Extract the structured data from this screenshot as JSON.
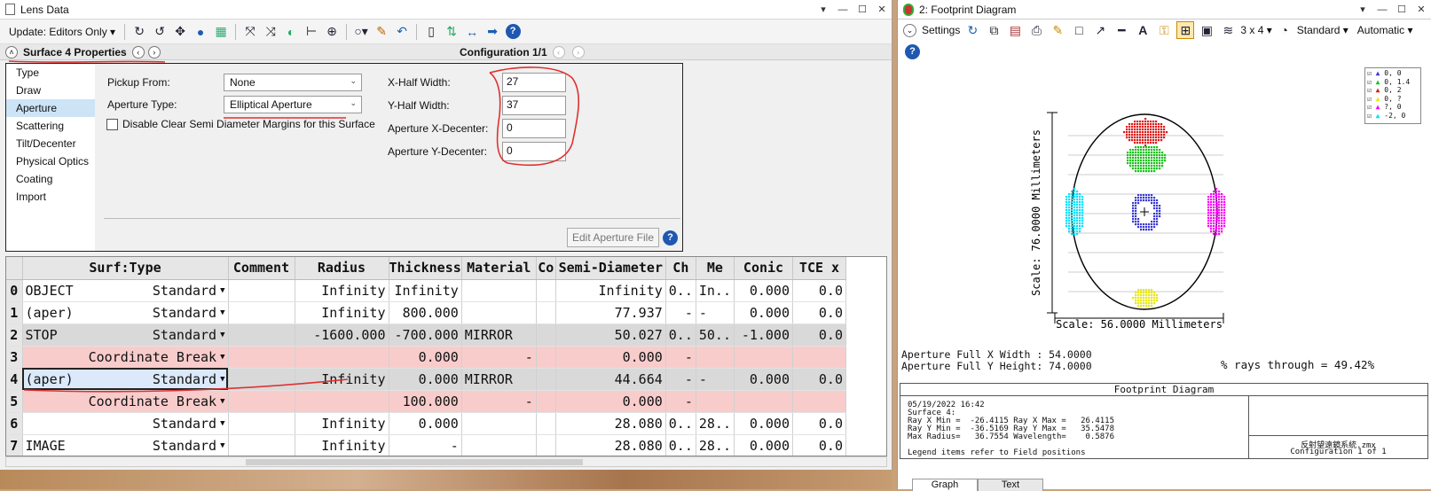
{
  "lens_window": {
    "title": "Lens Data",
    "update_label": "Update: Editors Only",
    "prop_title": "Surface 4 Properties",
    "config_label": "Configuration 1/1",
    "categories": [
      "Type",
      "Draw",
      "Aperture",
      "Scattering",
      "Tilt/Decenter",
      "Physical Optics",
      "Coating",
      "Import"
    ],
    "selected_category": "Aperture",
    "form": {
      "pickup_label": "Pickup From:",
      "pickup_value": "None",
      "aperture_type_label": "Aperture Type:",
      "aperture_type_value": "Elliptical Aperture",
      "disable_label": "Disable Clear Semi Diameter Margins for this Surface",
      "xhalf_label": "X-Half Width:",
      "xhalf_value": "27",
      "yhalf_label": "Y-Half Width:",
      "yhalf_value": "37",
      "xdec_label": "Aperture X-Decenter:",
      "xdec_value": "0",
      "ydec_label": "Aperture Y-Decenter:",
      "ydec_value": "0",
      "edit_button": "Edit Aperture File"
    },
    "table": {
      "headers": [
        "",
        "Surf:Type",
        "Comment",
        "Radius",
        "Thickness",
        "Material",
        "Co",
        "Semi-Diameter",
        "Ch",
        "Me",
        "Conic",
        "TCE x"
      ],
      "rows": [
        {
          "idx": "0",
          "name": "OBJECT",
          "type": "Standard",
          "comment": "",
          "radius": "Infinity",
          "thickness": "Infinity",
          "material": "",
          "semi": "Infinity",
          "ch": "0..",
          "me": "In..",
          "conic": "0.000",
          "tce": "0.0",
          "style": "white"
        },
        {
          "idx": "1",
          "name": "(aper)",
          "type": "Standard",
          "comment": "",
          "radius": "Infinity",
          "thickness": "800.000",
          "material": "",
          "semi": "77.937",
          "ch": "-",
          "me": "-",
          "conic": "0.000",
          "tce": "0.0",
          "style": "white"
        },
        {
          "idx": "2",
          "name": "STOP",
          "type": "Standard",
          "comment": "",
          "radius": "-1600.000",
          "thickness": "-700.000",
          "material": "MIRROR",
          "semi": "50.027",
          "ch": "0..",
          "me": "50..",
          "conic": "-1.000",
          "tce": "0.0",
          "style": "gray"
        },
        {
          "idx": "3",
          "name": "",
          "type": "Coordinate Break",
          "comment": "",
          "radius": "",
          "thickness": "0.000",
          "material": "-",
          "semi": "0.000",
          "ch": "-",
          "me": "",
          "conic": "",
          "tce": "",
          "style": "pink"
        },
        {
          "idx": "4",
          "name": "(aper)",
          "type": "Standard",
          "comment": "",
          "radius": "Infinity",
          "thickness": "0.000",
          "material": "MIRROR",
          "semi": "44.664",
          "ch": "-",
          "me": "-",
          "conic": "0.000",
          "tce": "0.0",
          "style": "gray"
        },
        {
          "idx": "5",
          "name": "",
          "type": "Coordinate Break",
          "comment": "",
          "radius": "",
          "thickness": "100.000",
          "material": "-",
          "semi": "0.000",
          "ch": "-",
          "me": "",
          "conic": "",
          "tce": "",
          "style": "pink"
        },
        {
          "idx": "6",
          "name": "",
          "type": "Standard",
          "comment": "",
          "radius": "Infinity",
          "thickness": "0.000",
          "material": "",
          "semi": "28.080",
          "ch": "0..",
          "me": "28..",
          "conic": "0.000",
          "tce": "0.0",
          "style": "white"
        },
        {
          "idx": "7",
          "name": "IMAGE",
          "type": "Standard",
          "comment": "",
          "radius": "Infinity",
          "thickness": "-",
          "material": "",
          "semi": "28.080",
          "ch": "0..",
          "me": "28..",
          "conic": "0.000",
          "tce": "0.0",
          "style": "white"
        }
      ]
    }
  },
  "footprint_window": {
    "title": "2: Footprint Diagram",
    "settings_label": "Settings",
    "layout_label": "3 x 4",
    "standard_label": "Standard",
    "automatic_label": "Automatic",
    "legend": [
      "0, 0",
      "0, 1.4",
      "0, 2",
      "0, ?",
      "?, 0",
      "-2, 0"
    ],
    "legend_colors": [
      "#3b3bd6",
      "#18c418",
      "#e01818",
      "#e8e800",
      "#ff00ff",
      "#00e0ff"
    ],
    "scale_y": "Scale: 76.0000 Millimeters",
    "scale_x": "Scale: 56.0000 Millimeters",
    "width_line": "Aperture Full X Width : 54.0000",
    "height_line": "Aperture Full Y Height: 74.0000",
    "rays_line": "% rays through = 49.42%",
    "box_title": "Footprint Diagram",
    "box_text": "05/19/2022 16:42\nSurface 4:\nRay X Min =  -26.4115 Ray X Max =   26.4115\nRay Y Min =  -36.5169 Ray Y Max =   35.5478\nMax Radius=   36.7554 Wavelength=    0.5876\n\nLegend items refer to Field positions",
    "file_name": "反射望遠鏡系統.zmx",
    "config_text": "Configuration 1 of 1",
    "tabs": [
      "Graph",
      "Text"
    ]
  }
}
